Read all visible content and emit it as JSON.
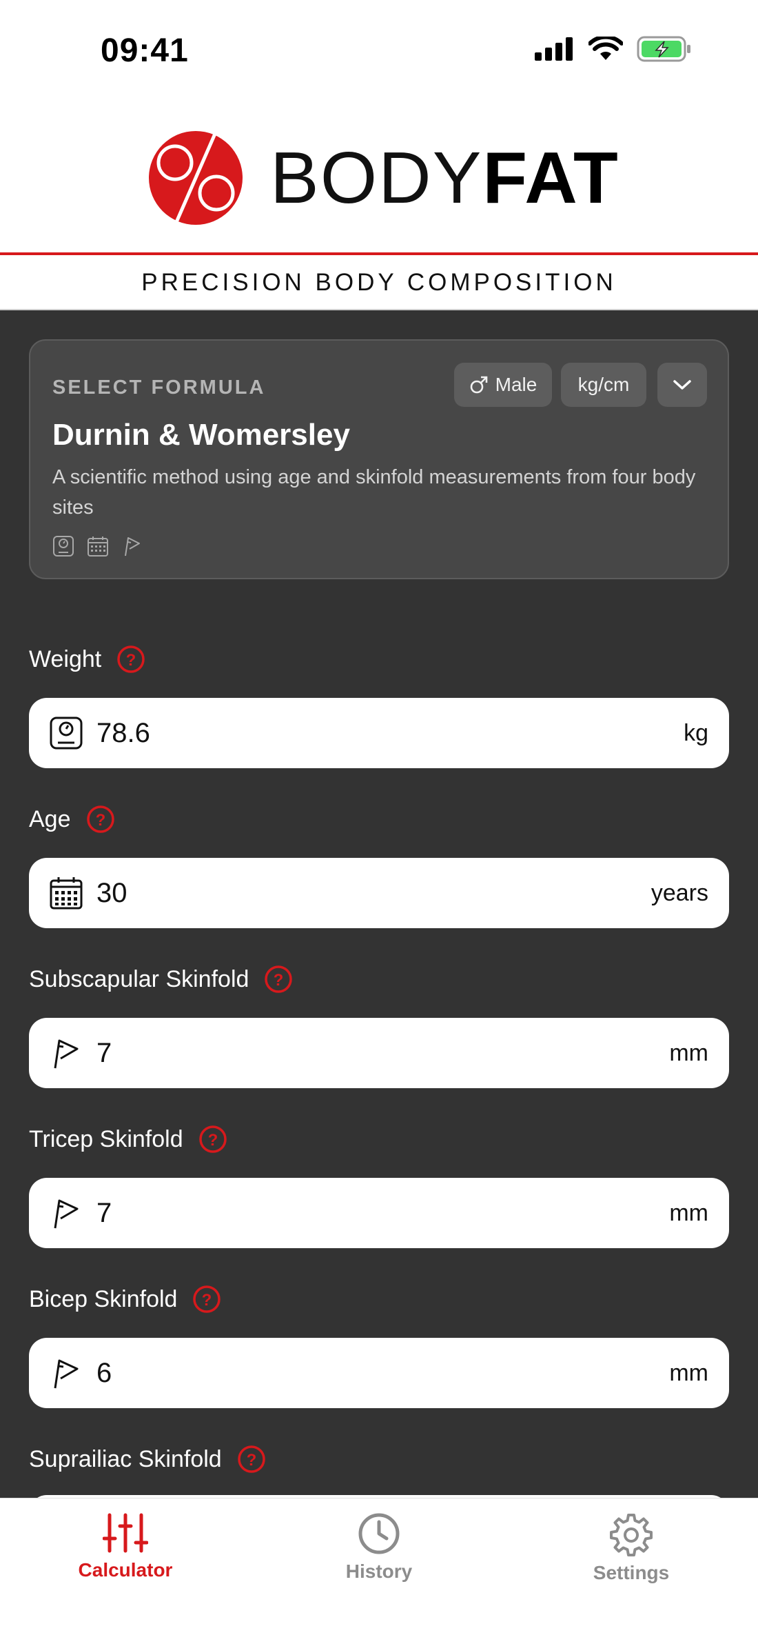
{
  "status_bar": {
    "time": "09:41"
  },
  "header": {
    "logo_word_light": "BODY",
    "logo_word_bold": "FAT",
    "tagline": "PRECISION BODY COMPOSITION"
  },
  "formula": {
    "section_label": "SELECT FORMULA",
    "gender": "Male",
    "units": "kg/cm",
    "title": "Durnin & Womersley",
    "description": "A scientific method using age and skinfold measurements from four body sites",
    "required_icons": [
      "scale-icon",
      "calendar-icon",
      "caliper-icon"
    ]
  },
  "fields": [
    {
      "label": "Weight",
      "value": "78.6",
      "unit": "kg",
      "icon": "scale-icon"
    },
    {
      "label": "Age",
      "value": "30",
      "unit": "years",
      "icon": "calendar-icon"
    },
    {
      "label": "Subscapular Skinfold",
      "value": "7",
      "unit": "mm",
      "icon": "caliper-icon"
    },
    {
      "label": "Tricep Skinfold",
      "value": "7",
      "unit": "mm",
      "icon": "caliper-icon"
    },
    {
      "label": "Bicep Skinfold",
      "value": "6",
      "unit": "mm",
      "icon": "caliper-icon"
    },
    {
      "label": "Suprailiac Skinfold"
    }
  ],
  "tabs": [
    {
      "label": "Calculator",
      "active": true
    },
    {
      "label": "History",
      "active": false
    },
    {
      "label": "Settings",
      "active": false
    }
  ],
  "colors": {
    "accent": "#d7191c",
    "background": "#333333",
    "card": "#474747",
    "inactive_tab": "#8c8c8c"
  }
}
